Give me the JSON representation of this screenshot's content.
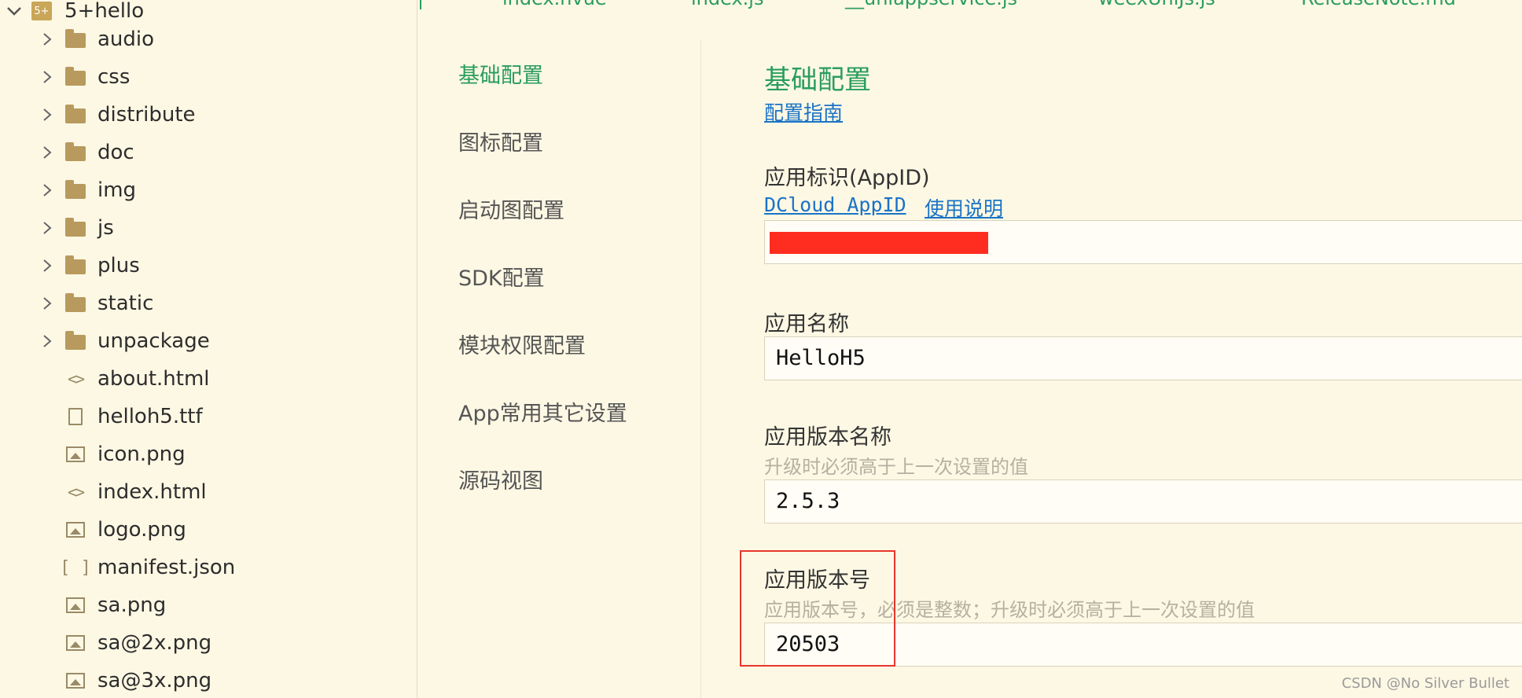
{
  "tree": {
    "root": {
      "icon_text": "5+",
      "label": "5+hello"
    },
    "items": [
      {
        "label": "audio",
        "type": "folder"
      },
      {
        "label": "css",
        "type": "folder"
      },
      {
        "label": "distribute",
        "type": "folder"
      },
      {
        "label": "doc",
        "type": "folder"
      },
      {
        "label": "img",
        "type": "folder"
      },
      {
        "label": "js",
        "type": "folder"
      },
      {
        "label": "plus",
        "type": "folder"
      },
      {
        "label": "static",
        "type": "folder"
      },
      {
        "label": "unpackage",
        "type": "folder"
      },
      {
        "label": "about.html",
        "type": "html"
      },
      {
        "label": "helloh5.ttf",
        "type": "file"
      },
      {
        "label": "icon.png",
        "type": "image"
      },
      {
        "label": "index.html",
        "type": "html"
      },
      {
        "label": "logo.png",
        "type": "image"
      },
      {
        "label": "manifest.json",
        "type": "json"
      },
      {
        "label": "sa.png",
        "type": "image"
      },
      {
        "label": "sa@2x.png",
        "type": "image"
      },
      {
        "label": "sa@3x.png",
        "type": "image"
      }
    ]
  },
  "tabs": [
    "index.nvue",
    "index.js",
    "__uniappservice.js",
    "weexUniJs.js",
    "ReleaseNote.md"
  ],
  "nav": {
    "items": [
      "基础配置",
      "图标配置",
      "启动图配置",
      "SDK配置",
      "模块权限配置",
      "App常用其它设置",
      "源码视图"
    ],
    "active_index": 0
  },
  "form": {
    "section_title": "基础配置",
    "guide_link": "配置指南",
    "appid": {
      "label": "应用标识(AppID)",
      "link_appid": "DCloud AppID ",
      "link_usage": "使用说明",
      "value": ""
    },
    "app_name": {
      "label": "应用名称",
      "value": "HelloH5"
    },
    "version_name": {
      "label": "应用版本名称",
      "hint": "升级时必须高于上一次设置的值",
      "value": "2.5.3"
    },
    "version_code": {
      "label": "应用版本号",
      "hint": "应用版本号，必须是整数；升级时必须高于上一次设置的值",
      "value": "20503"
    }
  },
  "watermark": "CSDN @No Silver Bullet",
  "colors": {
    "accent": "#2a9d5c",
    "link": "#1a73c7",
    "redaction": "#ff2d1f",
    "highlight": "#e8362c"
  }
}
